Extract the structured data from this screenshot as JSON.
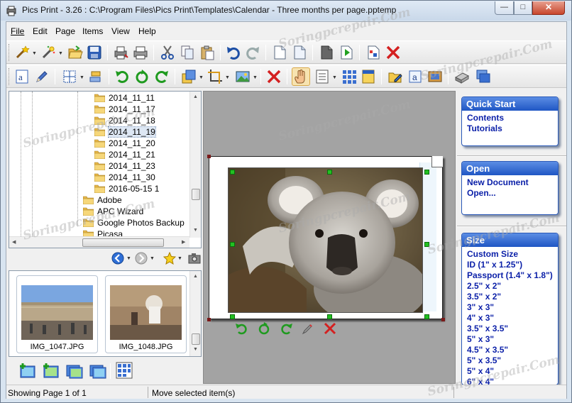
{
  "window": {
    "title": "Pics Print - 3.26 :  C:\\Program Files\\Pics Print\\Templates\\Calendar - Three months per page.pptemp",
    "minimize": "—",
    "maximize": "□",
    "close": "✕"
  },
  "menu": {
    "file": "File",
    "edit": "Edit",
    "page": "Page",
    "items": "Items",
    "view": "View",
    "help": "Help"
  },
  "toolbar1": [
    "magic-wand-icon",
    "auto-fix-icon",
    "open-folder-icon",
    "save-icon",
    "print-setup-icon",
    "print-icon",
    "cut-icon",
    "copy-icon",
    "paste-icon",
    "undo-icon",
    "redo-icon",
    "new-page-icon",
    "duplicate-page-icon",
    "previous-page-icon",
    "next-page-icon",
    "page-setup-icon",
    "delete-page-icon"
  ],
  "toolbar2": [
    "add-text-icon",
    "pencil-icon",
    "grid-icon",
    "align-icon",
    "rotate-left-icon",
    "rotate-icon",
    "rotate-right-icon",
    "bring-front-icon",
    "crop-icon",
    "picture-icon",
    "delete-item-icon",
    "hand-icon",
    "layout-icon",
    "thumbnails-grid-icon",
    "note-icon",
    "edit-folder-icon",
    "text-box-icon",
    "frame-icon",
    "scanner-icon",
    "windows-icon"
  ],
  "tree": {
    "items": [
      {
        "label": "2014_11_11",
        "selected": false
      },
      {
        "label": "2014_11_17",
        "selected": false
      },
      {
        "label": "2014_11_18",
        "selected": false
      },
      {
        "label": "2014_11_19",
        "selected": true
      },
      {
        "label": "2014_11_20",
        "selected": false
      },
      {
        "label": "2014_11_21",
        "selected": false
      },
      {
        "label": "2014_11_23",
        "selected": false
      },
      {
        "label": "2014_11_30",
        "selected": false
      },
      {
        "label": "2016-05-15 1",
        "selected": false
      },
      {
        "label": "Adobe",
        "selected": false
      },
      {
        "label": "APC Wizard",
        "selected": false
      },
      {
        "label": "Google Photos Backup",
        "selected": false
      },
      {
        "label": "Picasa",
        "selected": false
      }
    ]
  },
  "thumbnails": [
    {
      "name": "IMG_1047.JPG"
    },
    {
      "name": "IMG_1048.JPG"
    }
  ],
  "panels": {
    "quick_start": {
      "title": "Quick Start",
      "links": [
        "Contents",
        "Tutorials"
      ]
    },
    "open": {
      "title": "Open",
      "links": [
        "New Document",
        "Open..."
      ]
    },
    "size": {
      "title": "Size",
      "links": [
        "Custom Size",
        "ID (1\" x 1.25\")",
        "Passport (1.4\" x 1.8\")",
        "2.5\" x 2\"",
        "3.5\" x 2\"",
        "3\" x 3\"",
        "4\" x 3\"",
        "3.5\" x 3.5\"",
        "5\" x 3\"",
        "4.5\" x 3.5\"",
        "5\" x 3.5\"",
        "5\" x 4\"",
        "6\" x 4\""
      ]
    }
  },
  "status": {
    "page_info": "Showing Page 1 of 1",
    "hint": "Move selected item(s)"
  },
  "watermark": "Soringpcrepair.Com",
  "colors": {
    "panel_header": "#1f56c4",
    "link": "#0a1fa8",
    "handle": "#22c022"
  }
}
